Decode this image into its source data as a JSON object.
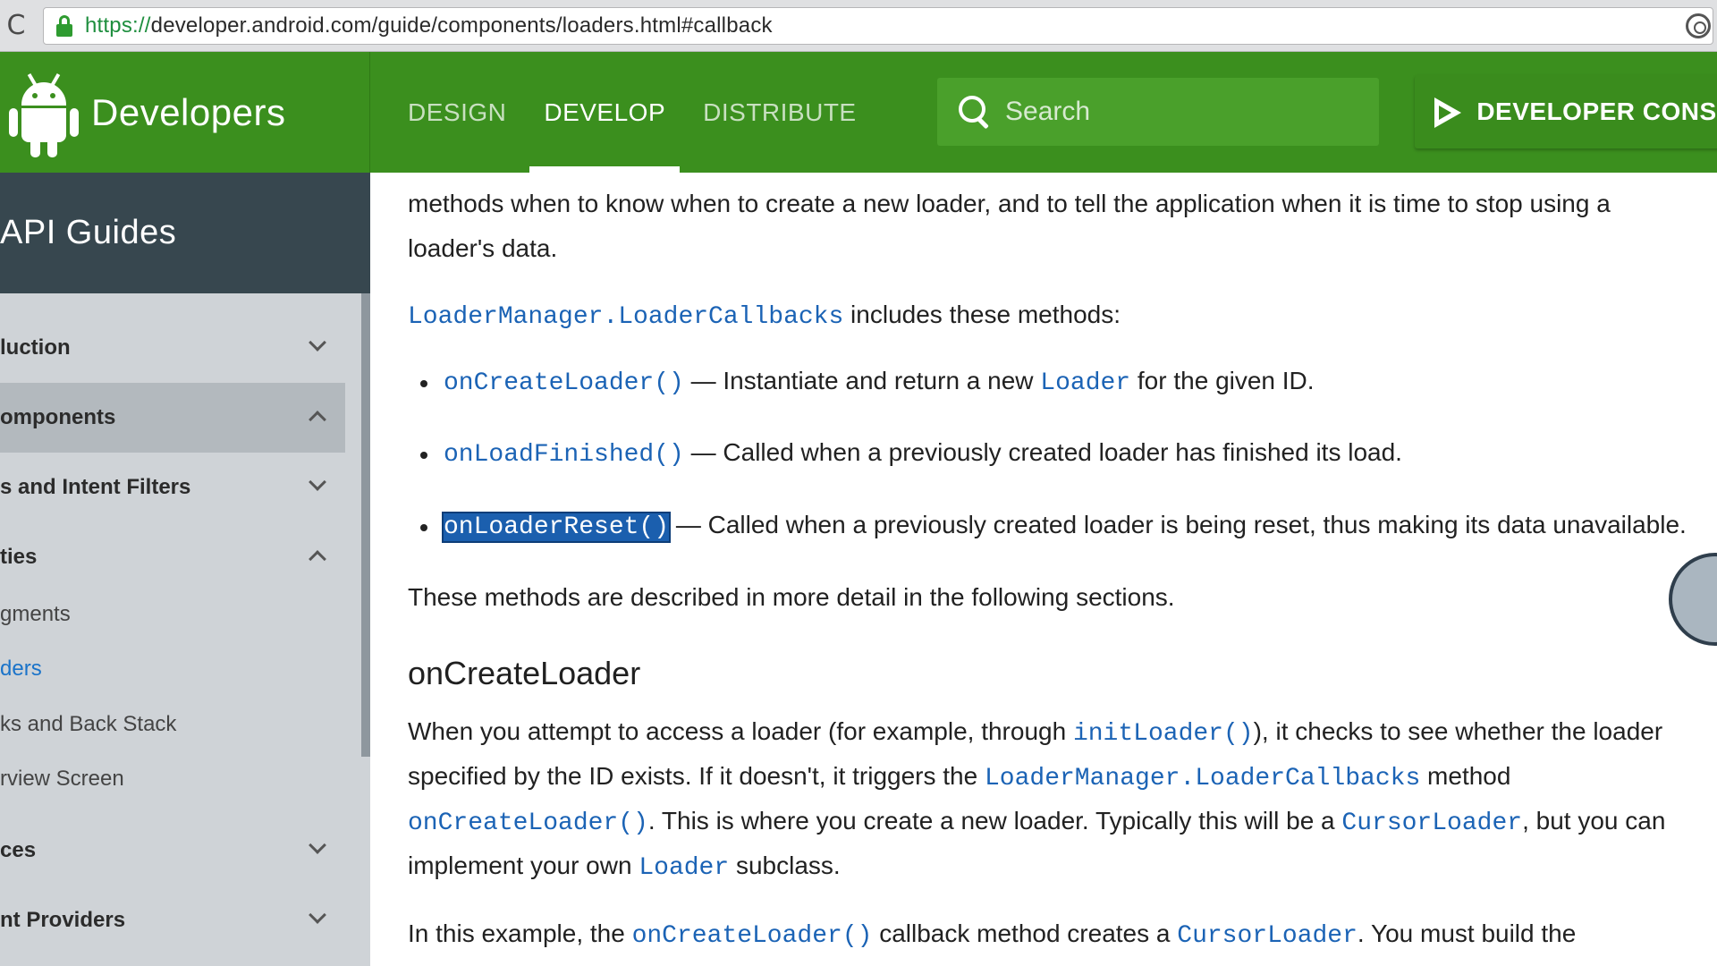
{
  "browser": {
    "url_scheme": "https://",
    "url_rest": "developer.android.com/guide/components/loaders.html#callback",
    "reload_glyph": "C"
  },
  "header": {
    "brand": "Developers",
    "tabs": [
      {
        "label": "DESIGN",
        "active": false
      },
      {
        "label": "DEVELOP",
        "active": true
      },
      {
        "label": "DISTRIBUTE",
        "active": false
      }
    ],
    "search_placeholder": "Search",
    "console_label": "DEVELOPER CONSO",
    "colors": {
      "header_bg": "#3b8f1e",
      "accent": "#ffffff"
    }
  },
  "sidebar": {
    "title": "API Guides",
    "items": [
      {
        "label": "luction",
        "type": "section",
        "chevron": "down"
      },
      {
        "label": "omponents",
        "type": "section",
        "chevron": "up",
        "expanded": true
      },
      {
        "label": "s and Intent Filters",
        "type": "section",
        "chevron": "down"
      },
      {
        "label": "ties",
        "type": "section",
        "chevron": "up"
      },
      {
        "label": "gments",
        "type": "sub"
      },
      {
        "label": "ders",
        "type": "sub",
        "active": true
      },
      {
        "label": "ks and Back Stack",
        "type": "sub"
      },
      {
        "label": "rview Screen",
        "type": "sub"
      },
      {
        "label": "ces",
        "type": "section",
        "chevron": "down"
      },
      {
        "label": "nt Providers",
        "type": "section",
        "chevron": "down"
      }
    ]
  },
  "content": {
    "intro_line1": "methods when to know when to create a new loader, and to tell the application when it is time to stop using a",
    "intro_line2": "loader's data.",
    "callbacks_code": "LoaderManager.LoaderCallbacks",
    "callbacks_text": " includes these methods:",
    "methods": [
      {
        "code": "onCreateLoader()",
        "text_a": " — Instantiate and return a new ",
        "code_b": "Loader",
        "text_b": " for the given ID."
      },
      {
        "code": "onLoadFinished()",
        "text_a": " — Called when a previously created loader has finished its load.",
        "code_b": "",
        "text_b": ""
      },
      {
        "code": "onLoaderReset()",
        "text_a": " — Called when a previously created loader is being reset, thus making its data unavailable.",
        "code_b": "",
        "text_b": "",
        "selected": true
      }
    ],
    "following_sections": "These methods are described in more detail in the following sections.",
    "heading": "onCreateLoader",
    "para1_a": "When you attempt to access a loader (for example, through ",
    "para1_code": "initLoader()",
    "para1_b": "), it checks to see whether the loader",
    "para2_a": "specified by the ID exists. If it doesn't, it triggers the ",
    "para2_code": "LoaderManager.LoaderCallbacks",
    "para2_b": " method",
    "para3_code": "onCreateLoader()",
    "para3_a": ". This is where you create a new loader. Typically this will be a ",
    "para3_code2": "CursorLoader",
    "para3_b": ", but you can",
    "para4_a": "implement your own ",
    "para4_code": "Loader",
    "para4_b": " subclass.",
    "para5_a": "In this example, the ",
    "para5_code": "onCreateLoader()",
    "para5_b": " callback method creates a ",
    "para5_code2": "CursorLoader",
    "para5_c": ". You must build the"
  }
}
